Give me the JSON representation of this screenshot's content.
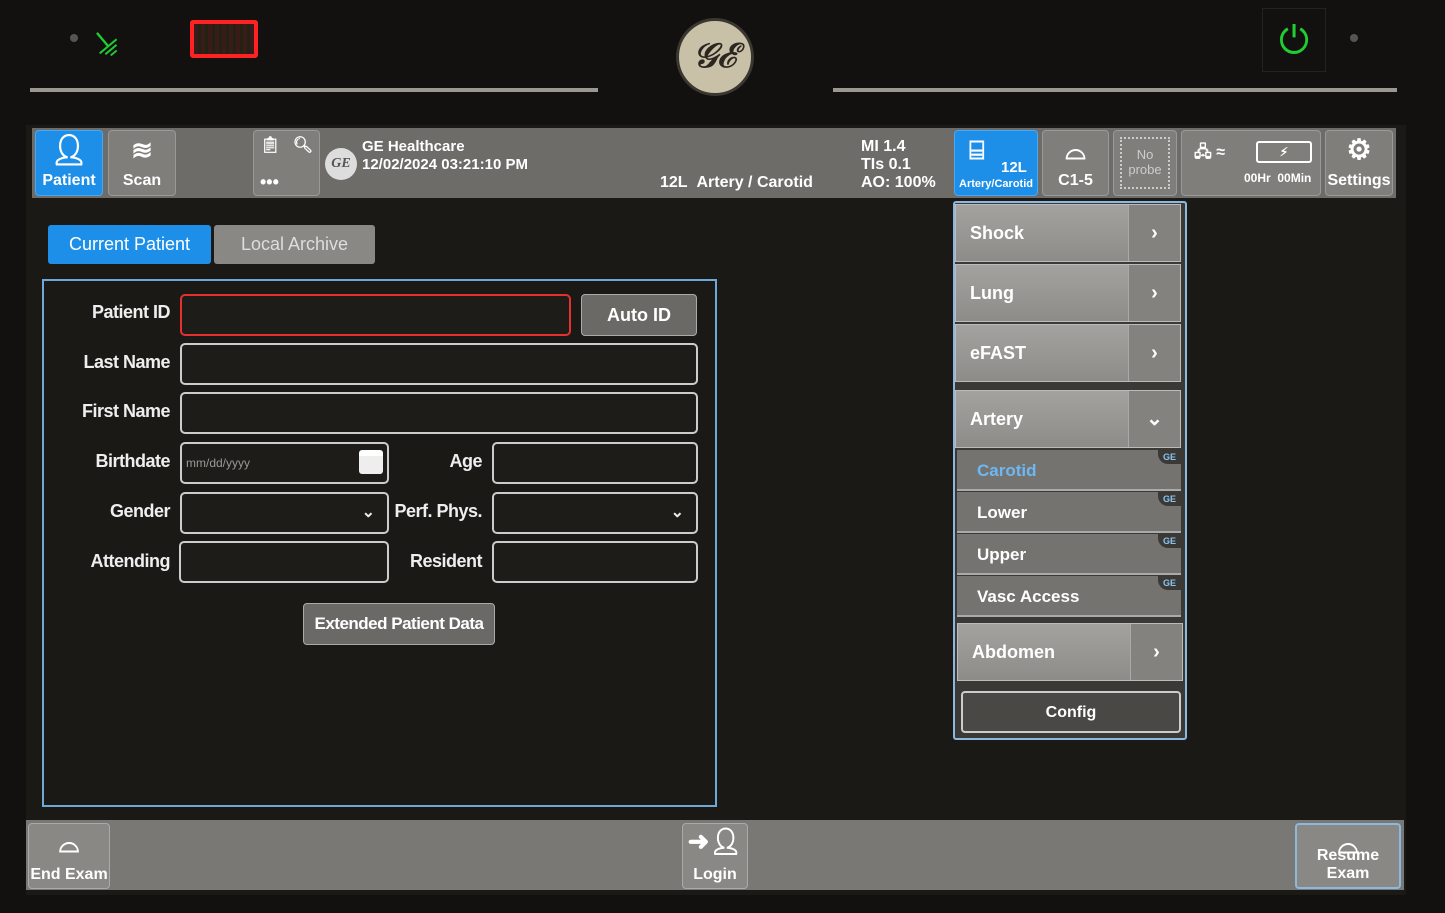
{
  "bezel": {
    "logo": "GE",
    "power_icon": "power-icon",
    "ac_icon": "plug-icon",
    "battery_icon": "battery-icon",
    "led_green": "#22cc33",
    "led_red": "#ff2222"
  },
  "topbar": {
    "patient": "Patient",
    "scan": "Scan",
    "company": "GE Healthcare",
    "datetime": "12/02/2024 03:21:10 PM",
    "probe_preset": "12L",
    "preset": "Artery / Carotid",
    "mi": "MI 1.4",
    "tis": "TIs 0.1",
    "ao": "AO: 100%",
    "probe1": {
      "name": "12L",
      "preset": "Artery/Carotid"
    },
    "probe2": {
      "name": "C1-5"
    },
    "probe3": {
      "line1": "No",
      "line2": "probe"
    },
    "battery_time": "00Hr  00Min",
    "settings": "Settings",
    "accent": "#1e8fe8"
  },
  "tabs": [
    {
      "label": "Current Patient",
      "active": true
    },
    {
      "label": "Local Archive",
      "active": false
    }
  ],
  "form": {
    "patient_id": {
      "label": "Patient ID",
      "value": ""
    },
    "auto_id": "Auto ID",
    "last_name": {
      "label": "Last Name",
      "value": ""
    },
    "first_name": {
      "label": "First Name",
      "value": ""
    },
    "birthdate": {
      "label": "Birthdate",
      "placeholder": "mm/dd/yyyy"
    },
    "age": {
      "label": "Age",
      "value": ""
    },
    "gender": {
      "label": "Gender",
      "value": ""
    },
    "perf_phys": {
      "label": "Perf. Phys.",
      "value": ""
    },
    "attending": {
      "label": "Attending",
      "value": ""
    },
    "resident": {
      "label": "Resident",
      "value": ""
    },
    "extended": "Extended Patient Data"
  },
  "menu": {
    "items": [
      {
        "label": "Shock"
      },
      {
        "label": "Lung"
      },
      {
        "label": "eFAST"
      },
      {
        "label": "Artery",
        "expanded": true
      },
      {
        "label": "Abdomen"
      }
    ],
    "sub": [
      {
        "label": "Carotid",
        "selected": true,
        "badge": "GE"
      },
      {
        "label": "Lower",
        "badge": "GE"
      },
      {
        "label": "Upper",
        "badge": "GE"
      },
      {
        "label": "Vasc Access",
        "badge": "GE"
      }
    ],
    "config": "Config"
  },
  "bottombar": {
    "end_exam": "End Exam",
    "login": "Login",
    "resume_exam": "Resume Exam"
  }
}
